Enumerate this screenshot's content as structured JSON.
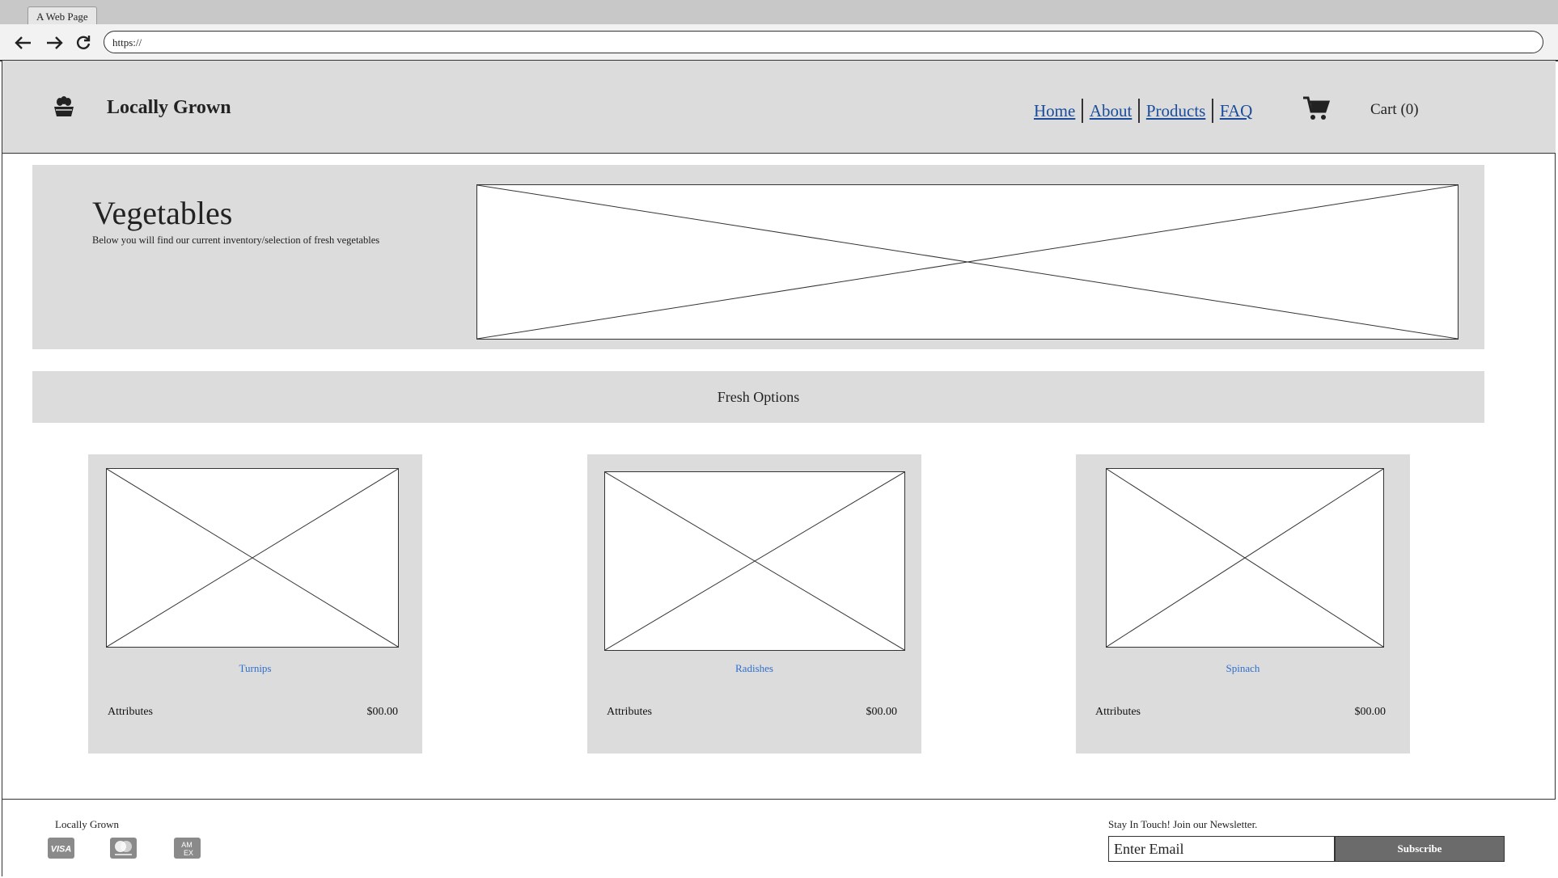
{
  "browser": {
    "tab_title": "A Web Page",
    "url": "https://"
  },
  "header": {
    "brand": "Locally Grown",
    "nav": [
      {
        "label": "Home"
      },
      {
        "label": "About"
      },
      {
        "label": "Products"
      },
      {
        "label": "FAQ"
      }
    ],
    "cart_label": "Cart (0)"
  },
  "hero": {
    "title": "Vegetables",
    "subtitle": "Below you will find our current inventory/selection of fresh vegetables"
  },
  "section": {
    "title": "Fresh Options"
  },
  "products": [
    {
      "name": "Turnips",
      "attributes_label": "Attributes",
      "price": "$00.00"
    },
    {
      "name": "Radishes",
      "attributes_label": "Attributes",
      "price": "$00.00"
    },
    {
      "name": "Spinach",
      "attributes_label": "Attributes",
      "price": "$00.00"
    }
  ],
  "footer": {
    "brand": "Locally Grown",
    "payment_icons": [
      "visa-icon",
      "mastercard-icon",
      "amex-icon"
    ],
    "newsletter_label": "Stay In Touch! Join our Newsletter.",
    "email_placeholder": "Enter Email",
    "subscribe_label": "Subscribe"
  },
  "colors": {
    "panel": "#dcdcdc",
    "link": "#1a4c9c",
    "product_link": "#2d6fd0",
    "button": "#6b6b6b"
  }
}
